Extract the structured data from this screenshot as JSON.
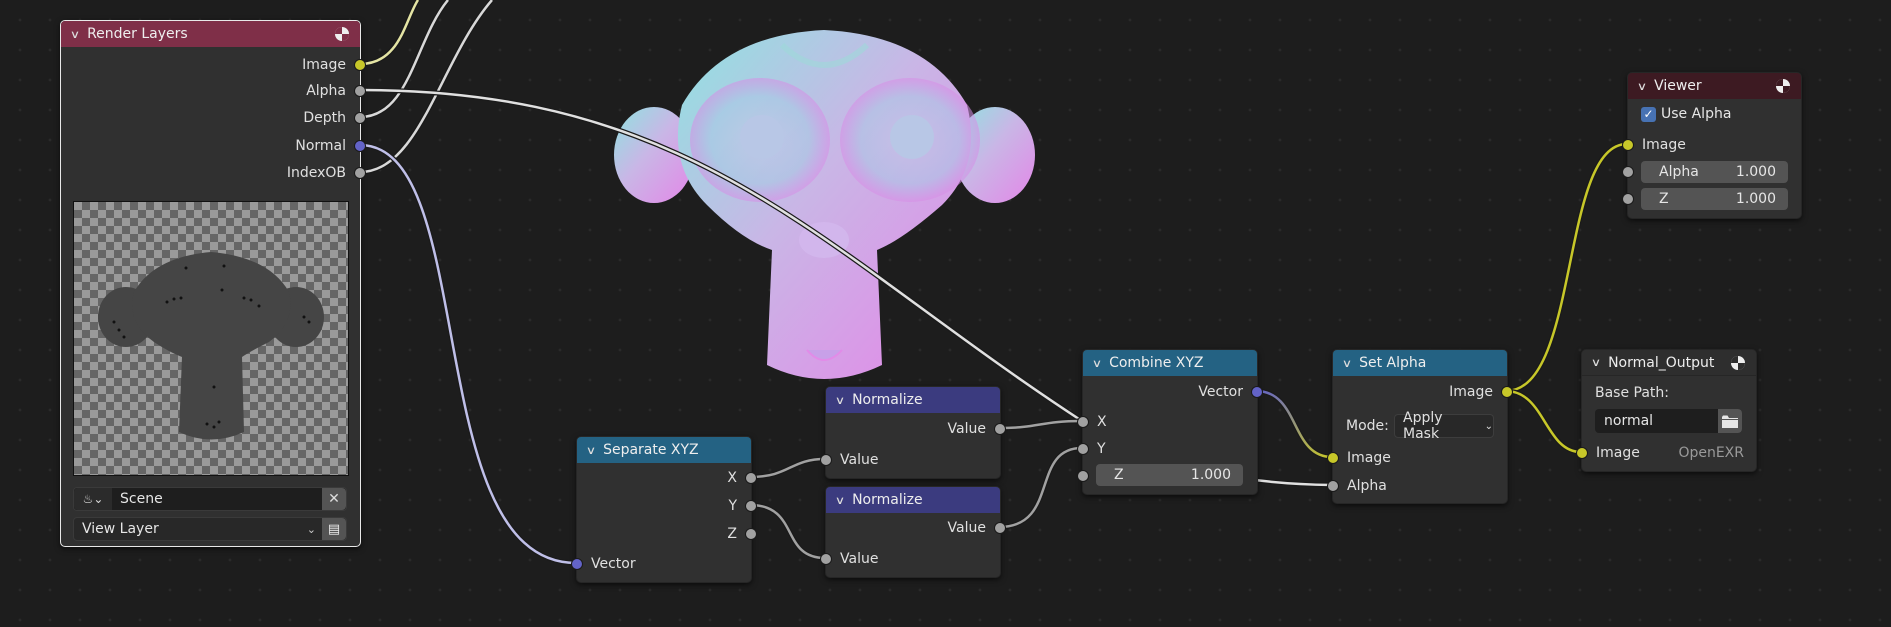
{
  "editor": "Compositor Node Editor",
  "colors": {
    "header_input": "#7f2f48",
    "header_converter": "#246283",
    "header_math": "#3b3b7f",
    "header_output": "#3d1a22",
    "socket_color": "#c7c729",
    "socket_value": "#a1a1a1",
    "socket_vector": "#6363c7"
  },
  "nodes": {
    "render_layers": {
      "title": "Render Layers",
      "outputs": [
        "Image",
        "Alpha",
        "Depth",
        "Normal",
        "IndexOB"
      ],
      "scene": "Scene",
      "view_layer": "View Layer"
    },
    "separate_xyz": {
      "title": "Separate XYZ",
      "outputs": [
        "X",
        "Y",
        "Z"
      ],
      "inputs": [
        "Vector"
      ]
    },
    "normalize_1": {
      "title": "Normalize",
      "output": "Value",
      "input": "Value"
    },
    "normalize_2": {
      "title": "Normalize",
      "output": "Value",
      "input": "Value"
    },
    "combine_xyz": {
      "title": "Combine XYZ",
      "output": "Vector",
      "inputs": [
        "X",
        "Y"
      ],
      "z_label": "Z",
      "z_value": "1.000"
    },
    "set_alpha": {
      "title": "Set Alpha",
      "output": "Image",
      "mode_label": "Mode:",
      "mode_value": "Apply Mask",
      "inputs": [
        "Image",
        "Alpha"
      ]
    },
    "viewer": {
      "title": "Viewer",
      "use_alpha_label": "Use Alpha",
      "use_alpha_checked": true,
      "image_label": "Image",
      "alpha_label": "Alpha",
      "alpha_value": "1.000",
      "z_label": "Z",
      "z_value": "1.000"
    },
    "normal_output": {
      "title": "Normal_Output",
      "base_path_label": "Base Path:",
      "base_path_value": "normal",
      "input_label": "Image",
      "format": "OpenEXR"
    }
  },
  "backdrop": {
    "label": "Backdrop preview of normal pass (Suzanne)"
  }
}
